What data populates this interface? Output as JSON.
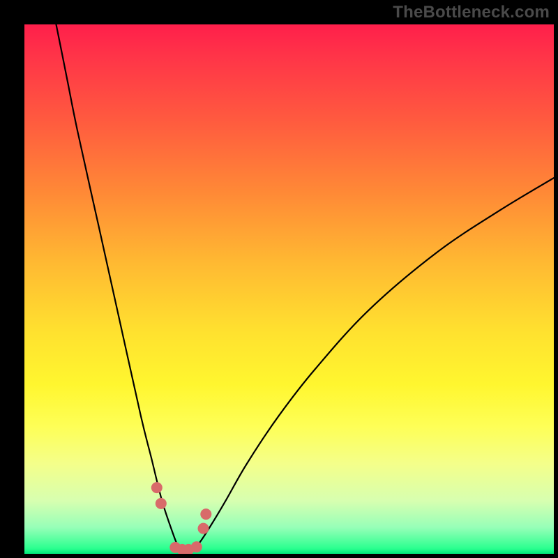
{
  "watermark": "TheBottleneck.com",
  "chart_data": {
    "type": "line",
    "title": "",
    "xlabel": "",
    "ylabel": "",
    "xlim": [
      0,
      100
    ],
    "ylim": [
      0,
      100
    ],
    "series": [
      {
        "name": "bottleneck-curve",
        "x": [
          6,
          8,
          10,
          14,
          18,
          22,
          24,
          26,
          28,
          29,
          30,
          31,
          32,
          33,
          35,
          38,
          42,
          48,
          55,
          65,
          78,
          90,
          100
        ],
        "y": [
          100,
          90,
          80,
          62,
          44,
          26,
          18,
          10,
          4,
          1.5,
          0.5,
          0.5,
          1,
          2,
          5,
          10,
          17,
          26,
          35,
          46,
          57,
          65,
          71
        ]
      }
    ],
    "markers": {
      "name": "highlight-dots",
      "x": [
        25.0,
        25.8,
        28.5,
        29.8,
        31.0,
        32.5,
        33.8,
        34.3
      ],
      "y": [
        12.5,
        9.5,
        1.2,
        0.8,
        0.8,
        1.3,
        4.8,
        7.5
      ]
    },
    "background_gradient": {
      "top": "#ff1f4b",
      "mid": "#ffe12f",
      "bottom": "#00e87a"
    }
  }
}
